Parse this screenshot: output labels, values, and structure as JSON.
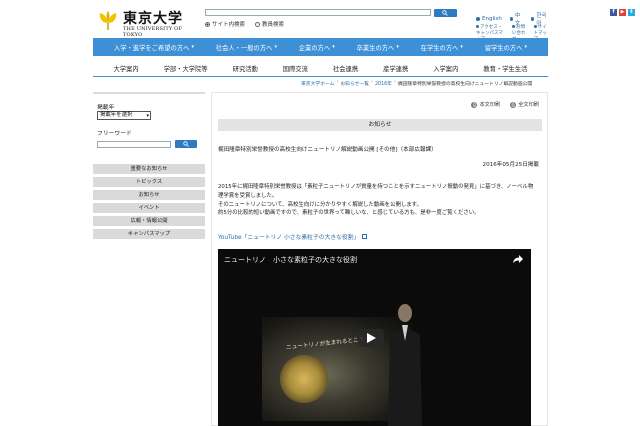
{
  "header": {
    "logo_jp": "東京大学",
    "logo_en": "THE UNIVERSITY OF TOKYO",
    "search_radio_site": "サイト内検索",
    "search_radio_faculty": "教員検索",
    "languages": [
      "English",
      "中文",
      "한국어"
    ],
    "utility_links": [
      "アクセス・キャンパスマップ",
      "お問い合わせ",
      "サイトマップ"
    ]
  },
  "mainnav": [
    "入学・進学をご希望の方へ",
    "社会人・一般の方へ",
    "企業の方へ",
    "卒業生の方へ",
    "在学生の方へ",
    "留学生の方へ"
  ],
  "subnav": [
    "大学案内",
    "学部・大学院等",
    "研究活動",
    "国際交流",
    "社会連携",
    "産学連携",
    "入学案内",
    "教育・学生生活"
  ],
  "breadcrumb": {
    "items": [
      "東京大学ホーム",
      "お知らせ一覧",
      "2016年"
    ],
    "current": "梶田隆章特別栄誉教授の高校生向けニュートリノ解説動画公開"
  },
  "sidebar": {
    "year_label": "掲載年",
    "year_select": "掲載年を選択",
    "keyword_label": "フリーワード",
    "menu": [
      "重要なお知らせ",
      "トピックス",
      "お知らせ",
      "イベント",
      "広報・情報公開",
      "キャンパスマップ"
    ]
  },
  "content": {
    "print_text": "本文印刷",
    "print_all": "全文印刷",
    "section_title": "お知らせ",
    "article_title": "梶田隆章特別栄誉教授の高校生向けニュートリノ解説動画公開 [その他]（本部広報課）",
    "date": "2016年05月25日掲載",
    "paragraphs": [
      "2015年に梶田隆章特別栄誉教授は「素粒子ニュートリノが質量を持つことを示すニュートリノ振動の発見」に基づき、ノーベル物理学賞を受賞しました。",
      "そのニュートリノについて、高校生向けに分かりやすく解説した動画を公開します。",
      "約5分の比較的短い動画ですので、素粒子の世界って難しいな、と感じている方も、是非一度ご覧ください。"
    ],
    "youtube_link": "YouTube「ニュートリノ 小さな素粒子の大きな役割」",
    "video_title": "ニュートリノ　小さな素粒子の大きな役割",
    "video_screen_text": "ニュートリノが生まれるところ"
  },
  "colors": {
    "nav_blue": "#3d8fd6",
    "sidebar_gray": "#dadada",
    "link_blue": "#2e6da4"
  }
}
